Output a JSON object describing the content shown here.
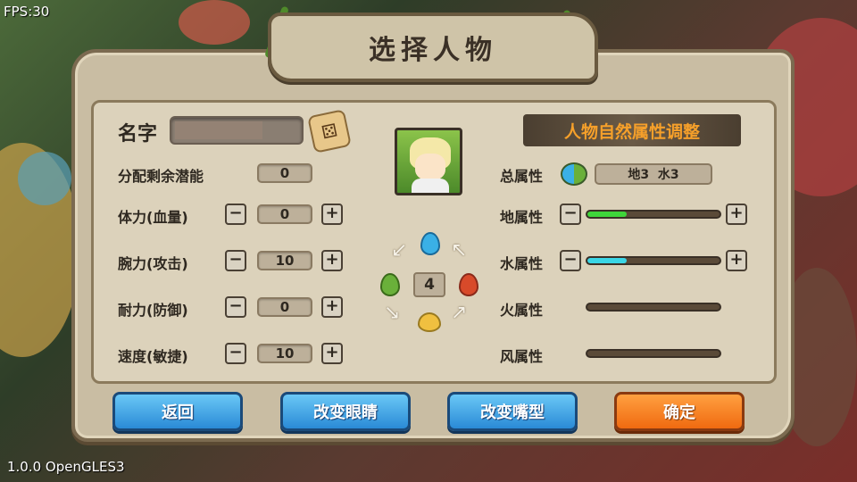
{
  "hud": {
    "fps": "FPS:30",
    "version": "1.0.0 OpenGLES3"
  },
  "title": "选择人物",
  "name": {
    "label": "名字",
    "value": ""
  },
  "stats": {
    "remaining_label": "分配剩余潜能",
    "remaining": "0",
    "items": [
      {
        "label": "体力(血量)",
        "value": "0"
      },
      {
        "label": "腕力(攻击)",
        "value": "10"
      },
      {
        "label": "耐力(防御)",
        "value": "0"
      },
      {
        "label": "速度(敏捷)",
        "value": "10"
      }
    ],
    "minus": "−",
    "plus": "+"
  },
  "element_wheel": {
    "center_value": "4"
  },
  "attributes": {
    "header": "人物自然属性调整",
    "total_label": "总属性",
    "total_value": "地3  水3",
    "items": [
      {
        "label": "地属性",
        "level": 0.3,
        "color": "#3fd63a",
        "adjustable": true
      },
      {
        "label": "水属性",
        "level": 0.3,
        "color": "#3ad6e6",
        "adjustable": true
      },
      {
        "label": "火属性",
        "level": 0,
        "color": "#d64a2a",
        "adjustable": false
      },
      {
        "label": "风属性",
        "level": 0,
        "color": "#e6c03a",
        "adjustable": false
      }
    ]
  },
  "buttons": {
    "back": "返回",
    "change_eyes": "改变眼睛",
    "change_mouth": "改变嘴型",
    "confirm": "确定"
  }
}
